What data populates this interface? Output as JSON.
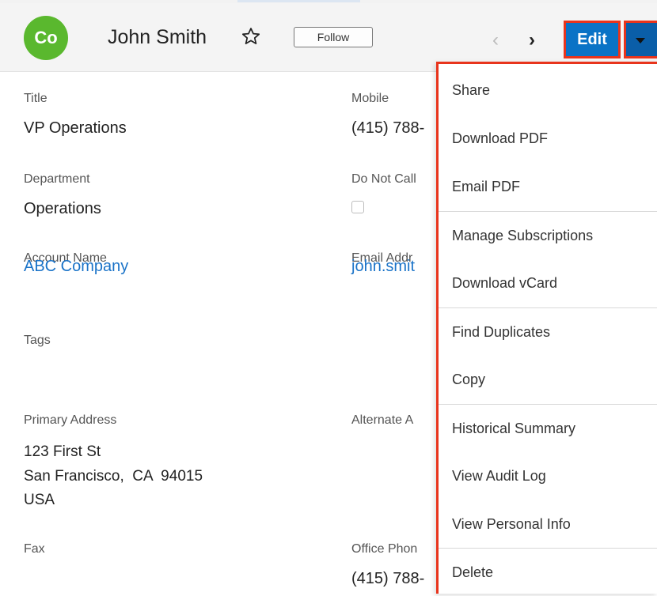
{
  "record": {
    "avatar_initials": "Co",
    "name": "John Smith",
    "follow_label": "Follow",
    "edit_label": "Edit"
  },
  "fields": {
    "title": {
      "label": "Title",
      "value": "VP Operations"
    },
    "mobile": {
      "label": "Mobile",
      "value": "(415) 788-"
    },
    "department": {
      "label": "Department",
      "value": "Operations"
    },
    "do_not_call": {
      "label": "Do Not Call"
    },
    "account_name": {
      "label": "Account Name",
      "value": "ABC Company"
    },
    "email": {
      "label": "Email Addr",
      "value": "john.smit"
    },
    "tags": {
      "label": "Tags"
    },
    "primary_address": {
      "label": "Primary Address",
      "line1": "123 First St",
      "line2": "San Francisco,  CA  94015",
      "line3": "USA"
    },
    "alternate_address": {
      "label": "Alternate A"
    },
    "fax": {
      "label": "Fax"
    },
    "office_phone": {
      "label": "Office Phon",
      "value": "(415) 788-"
    }
  },
  "menu": {
    "items": [
      {
        "label": "Share"
      },
      {
        "label": "Download PDF"
      },
      {
        "label": "Email PDF"
      },
      {
        "label": "Manage Subscriptions"
      },
      {
        "label": "Download vCard"
      },
      {
        "label": "Find Duplicates"
      },
      {
        "label": "Copy"
      },
      {
        "label": "Historical Summary"
      },
      {
        "label": "View Audit Log"
      },
      {
        "label": "View Personal Info"
      },
      {
        "label": "Delete"
      }
    ]
  },
  "colors": {
    "avatar": "#5ab82e",
    "primary_button": "#0a73c6",
    "highlight_border": "#e8341c",
    "link": "#1a73c8"
  }
}
